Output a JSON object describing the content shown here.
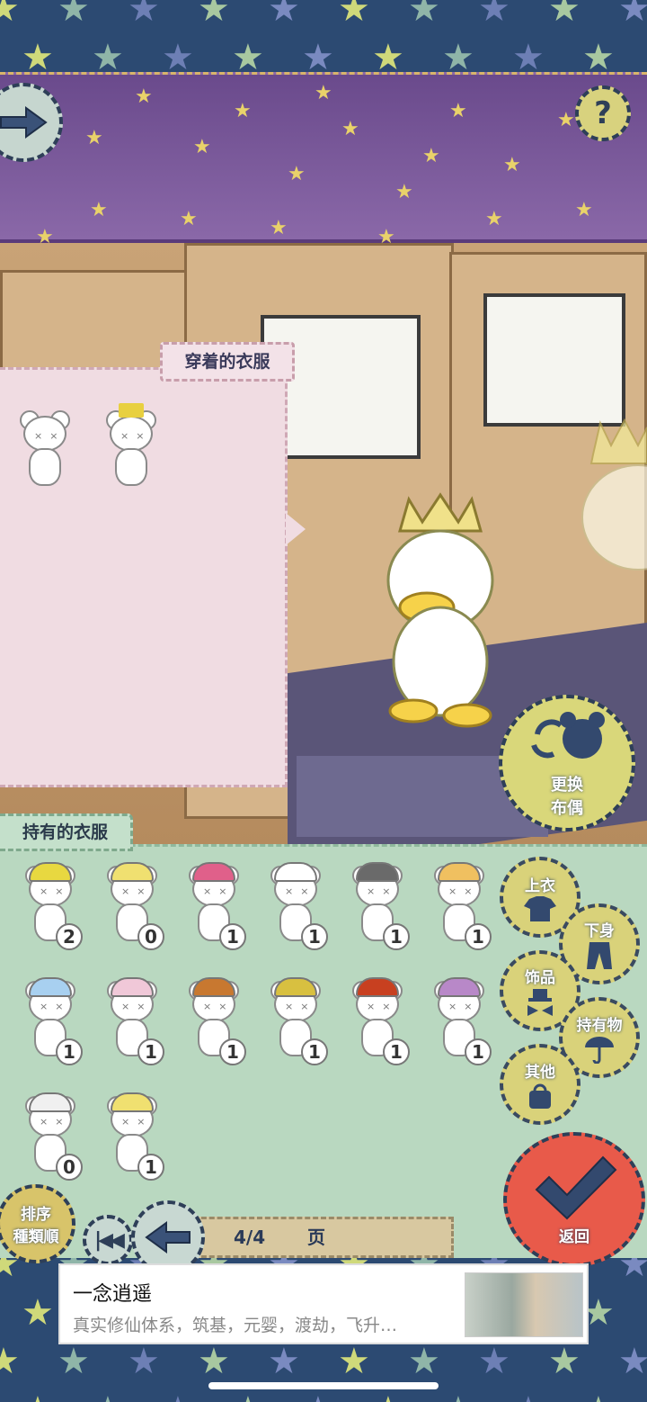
{
  "worn_panel": {
    "title": "穿着的衣服"
  },
  "owned_panel": {
    "title": "持有的衣服"
  },
  "change_doll_button": {
    "label_line1": "更换",
    "label_line2": "布偶"
  },
  "categories": [
    {
      "label": "上衣",
      "icon": "shirt-icon"
    },
    {
      "label": "下身",
      "icon": "pants-icon"
    },
    {
      "label": "饰品",
      "icon": "bowtie-hat-icon"
    },
    {
      "label": "持有物",
      "icon": "umbrella-icon"
    },
    {
      "label": "其他",
      "icon": "bag-icon"
    }
  ],
  "sort_button": {
    "line1": "排序",
    "line2": "種類順"
  },
  "pagination": {
    "current": "4/4",
    "suffix": "页"
  },
  "return_button": {
    "label": "返回"
  },
  "owned_items": [
    {
      "count": "2",
      "hat": "#e8d840"
    },
    {
      "count": "0",
      "hat": "#f0e070"
    },
    {
      "count": "1",
      "hat": "#e0608a"
    },
    {
      "count": "1",
      "hat": "#ffffff"
    },
    {
      "count": "1",
      "hat": "#6a6a6a"
    },
    {
      "count": "1",
      "hat": "#f0c060"
    },
    {
      "count": "1",
      "hat": "#a8d0f0"
    },
    {
      "count": "1",
      "hat": "#f0c8d8"
    },
    {
      "count": "1",
      "hat": "#c87830"
    },
    {
      "count": "1",
      "hat": "#d8c040"
    },
    {
      "count": "1",
      "hat": "#c84020"
    },
    {
      "count": "1",
      "hat": "#b888c8"
    },
    {
      "count": "0",
      "hat": "#f0f0f0"
    },
    {
      "count": "1",
      "hat": "#f0e070"
    }
  ],
  "ad": {
    "title": "一念逍遥",
    "subtitle": "真实修仙体系，筑基，元婴，渡劫，飞升…"
  },
  "colors": {
    "ceiling": "#7a58a0",
    "owned_panel": "#b9d8c0",
    "worn_panel": "#f0dce2",
    "return_button": "#e85a4a",
    "category_button": "#d9d27a"
  }
}
